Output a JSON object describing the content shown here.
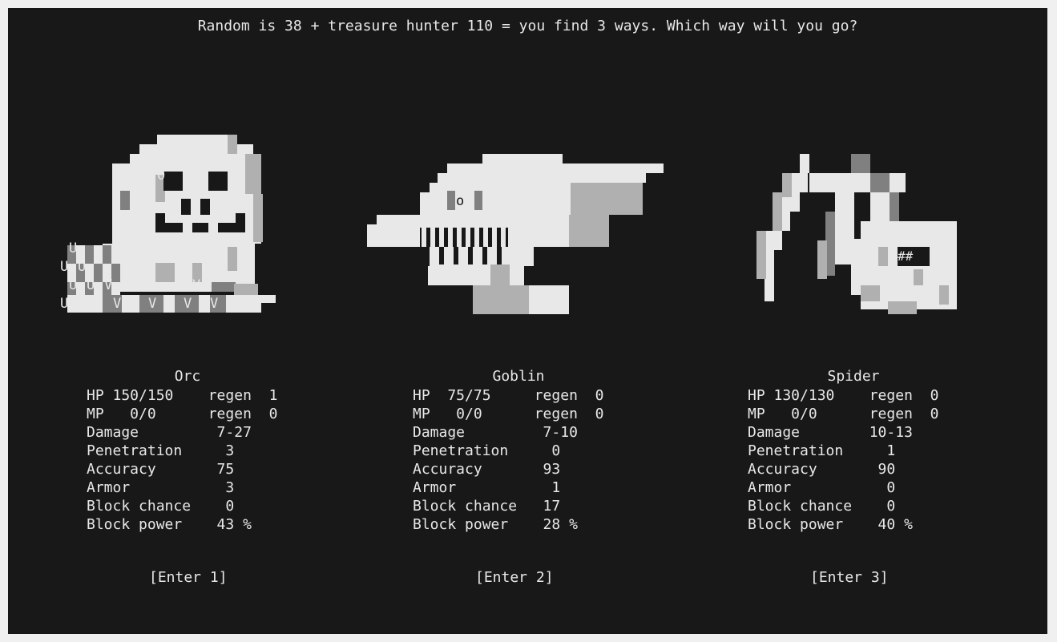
{
  "prompt": "Random is 38 + treasure hunter 110 = you find 3 ways. Which way will you go?",
  "colors": {
    "background": "#181818",
    "text": "#e8e8e8",
    "light": "#e8e8e8",
    "mid": "#b0b0b0",
    "dark": "#808080"
  },
  "monsters": [
    {
      "name": "Orc",
      "stats": [
        "HP 150/150    regen  1",
        "MP   0/0      regen  0",
        "Damage         7-27",
        "Penetration     3",
        "Accuracy       75",
        "Armor           3",
        "Block chance    0",
        "Block power    43 %"
      ],
      "enter": "[Enter 1]",
      "glyphs": [
        "0",
        "0",
        "U",
        "U",
        "U",
        "U",
        "U",
        "V",
        "V",
        "U",
        "V",
        "V",
        "V",
        "V"
      ]
    },
    {
      "name": "Goblin",
      "stats": [
        "HP  75/75     regen  0",
        "MP   0/0      regen  0",
        "Damage         7-10",
        "Penetration     0",
        "Accuracy       93",
        "Armor           1",
        "Block chance   17",
        "Block power    28 %"
      ],
      "enter": "[Enter 2]",
      "glyphs": [
        "o"
      ]
    },
    {
      "name": "Spider",
      "stats": [
        "HP 130/130    regen  0",
        "MP   0/0      regen  0",
        "Damage        10-13",
        "Penetration     1",
        "Accuracy       90",
        "Armor           0",
        "Block chance    0",
        "Block power    40 %"
      ],
      "enter": "[Enter 3]",
      "glyphs": [
        "##"
      ]
    }
  ]
}
